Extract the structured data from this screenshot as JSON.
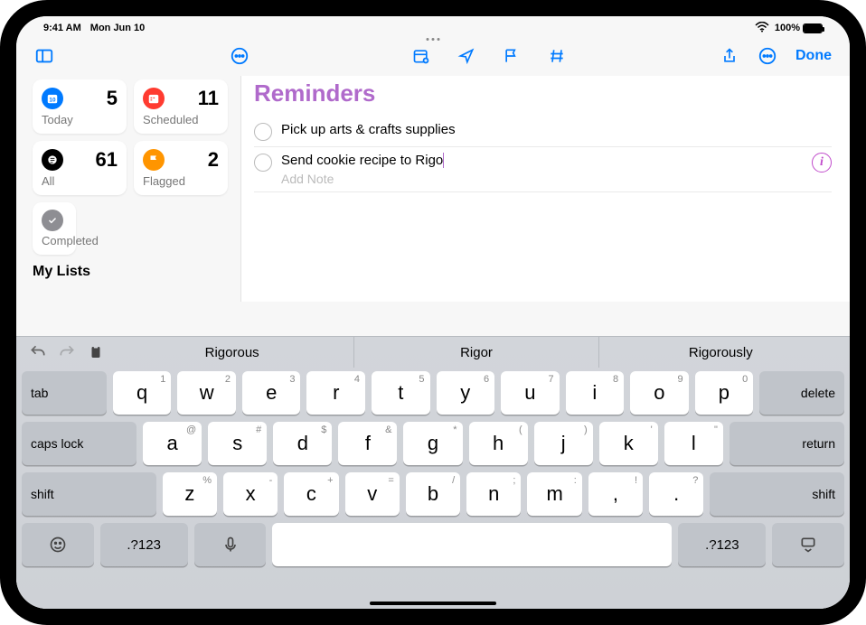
{
  "status": {
    "time": "9:41 AM",
    "date": "Mon Jun 10",
    "wifi_icon": "wifi",
    "battery_pct": "100%"
  },
  "toolbar": {
    "sidebar_icon": "sidebar",
    "more_icon": "ellipsis",
    "detail_icons": [
      "calendar-plus",
      "location",
      "flag",
      "hash"
    ],
    "share_icon": "share",
    "more2_icon": "ellipsis",
    "done_label": "Done"
  },
  "sidebar": {
    "smart": [
      {
        "name": "today",
        "label": "Today",
        "count": 5,
        "color": "#007aff"
      },
      {
        "name": "scheduled",
        "label": "Scheduled",
        "count": 11,
        "color": "#ff3b30"
      },
      {
        "name": "all",
        "label": "All",
        "count": 61,
        "color": "#000000"
      },
      {
        "name": "flagged",
        "label": "Flagged",
        "count": 2,
        "color": "#ff9500"
      },
      {
        "name": "completed",
        "label": "Completed",
        "count": null,
        "color": "#8e8e93"
      }
    ],
    "lists_header": "My Lists"
  },
  "main": {
    "title": "Reminders",
    "accent": "#b06acb",
    "items": [
      {
        "title": "Pick up arts & crafts supplies",
        "editing": false
      },
      {
        "title": "Send cookie recipe to Rigo",
        "editing": true
      }
    ],
    "note_placeholder": "Add Note"
  },
  "keyboard": {
    "suggestions": [
      "Rigorous",
      "Rigor",
      "Rigorously"
    ],
    "rows": [
      [
        {
          "wide": "tab",
          "gray": true
        },
        {
          "main": "q",
          "sub": "1"
        },
        {
          "main": "w",
          "sub": "2"
        },
        {
          "main": "e",
          "sub": "3"
        },
        {
          "main": "r",
          "sub": "4"
        },
        {
          "main": "t",
          "sub": "5"
        },
        {
          "main": "y",
          "sub": "6"
        },
        {
          "main": "u",
          "sub": "7"
        },
        {
          "main": "i",
          "sub": "8"
        },
        {
          "main": "o",
          "sub": "9"
        },
        {
          "main": "p",
          "sub": "0"
        },
        {
          "wide": "delete",
          "gray": true,
          "right": true
        }
      ],
      [
        {
          "wide": "caps lock",
          "gray": true,
          "flex": 1.8
        },
        {
          "main": "a",
          "sub": "@"
        },
        {
          "main": "s",
          "sub": "#"
        },
        {
          "main": "d",
          "sub": "$"
        },
        {
          "main": "f",
          "sub": "&"
        },
        {
          "main": "g",
          "sub": "*"
        },
        {
          "main": "h",
          "sub": "("
        },
        {
          "main": "j",
          "sub": ")"
        },
        {
          "main": "k",
          "sub": "'"
        },
        {
          "main": "l",
          "sub": "\""
        },
        {
          "wide": "return",
          "gray": true,
          "right": true,
          "flex": 1.8
        }
      ],
      [
        {
          "wide": "shift",
          "gray": true,
          "flex": 2.3
        },
        {
          "main": "z",
          "sub": "%"
        },
        {
          "main": "x",
          "sub": "-"
        },
        {
          "main": "c",
          "sub": "+"
        },
        {
          "main": "v",
          "sub": "="
        },
        {
          "main": "b",
          "sub": "/"
        },
        {
          "main": "n",
          "sub": ";"
        },
        {
          "main": "m",
          "sub": ":"
        },
        {
          "main": ",",
          "sub": "!"
        },
        {
          "main": ".",
          "sub": "?"
        },
        {
          "wide": "shift",
          "gray": true,
          "right": true,
          "flex": 2.3
        }
      ],
      [
        {
          "icon": "emoji",
          "gray": true,
          "flex": 0.9
        },
        {
          "main": ".?123",
          "gray": true,
          "flex": 1.1,
          "small": true
        },
        {
          "icon": "mic",
          "gray": true,
          "flex": 0.9
        },
        {
          "space": true
        },
        {
          "main": ".?123",
          "gray": true,
          "flex": 1.1,
          "small": true
        },
        {
          "icon": "dismiss",
          "gray": true,
          "flex": 0.9
        }
      ]
    ]
  }
}
